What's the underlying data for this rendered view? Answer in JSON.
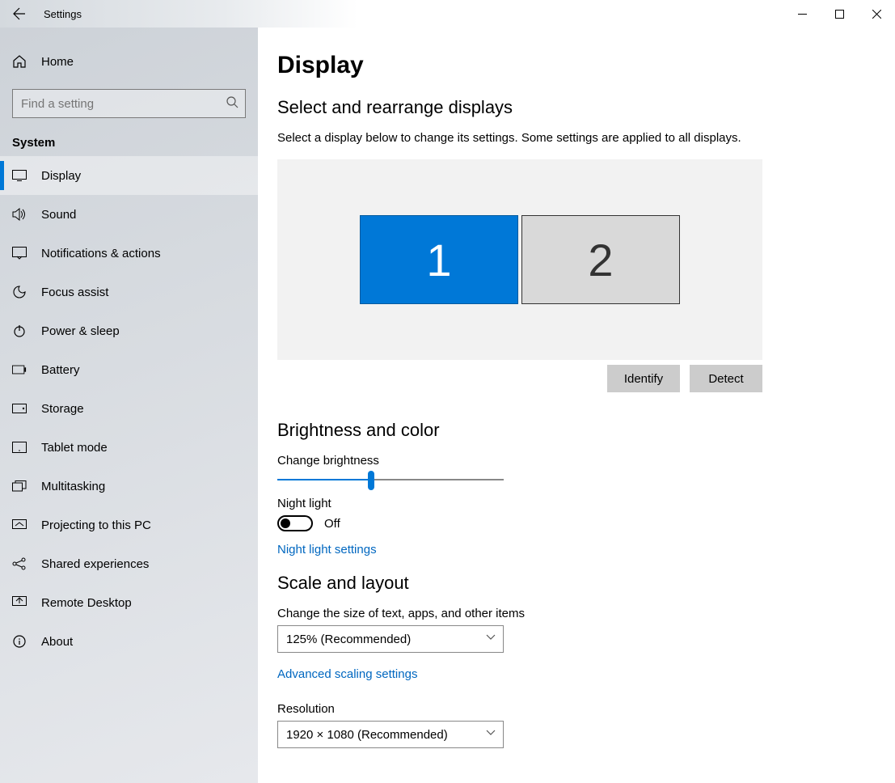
{
  "window": {
    "title": "Settings"
  },
  "sidebar": {
    "home": "Home",
    "search_placeholder": "Find a setting",
    "category": "System",
    "items": [
      {
        "label": "Display"
      },
      {
        "label": "Sound"
      },
      {
        "label": "Notifications & actions"
      },
      {
        "label": "Focus assist"
      },
      {
        "label": "Power & sleep"
      },
      {
        "label": "Battery"
      },
      {
        "label": "Storage"
      },
      {
        "label": "Tablet mode"
      },
      {
        "label": "Multitasking"
      },
      {
        "label": "Projecting to this PC"
      },
      {
        "label": "Shared experiences"
      },
      {
        "label": "Remote Desktop"
      },
      {
        "label": "About"
      }
    ]
  },
  "main": {
    "page_title": "Display",
    "arrange": {
      "heading": "Select and rearrange displays",
      "description": "Select a display below to change its settings. Some settings are applied to all displays.",
      "displays": [
        "1",
        "2"
      ],
      "identify": "Identify",
      "detect": "Detect"
    },
    "brightness": {
      "heading": "Brightness and color",
      "change_label": "Change brightness",
      "slider_percent": 40,
      "nightlight_label": "Night light",
      "nightlight_state": "Off",
      "nightlight_link": "Night light settings"
    },
    "scale": {
      "heading": "Scale and layout",
      "size_label": "Change the size of text, apps, and other items",
      "size_value": "125% (Recommended)",
      "advanced_link": "Advanced scaling settings",
      "resolution_label": "Resolution",
      "resolution_value": "1920 × 1080 (Recommended)"
    }
  }
}
